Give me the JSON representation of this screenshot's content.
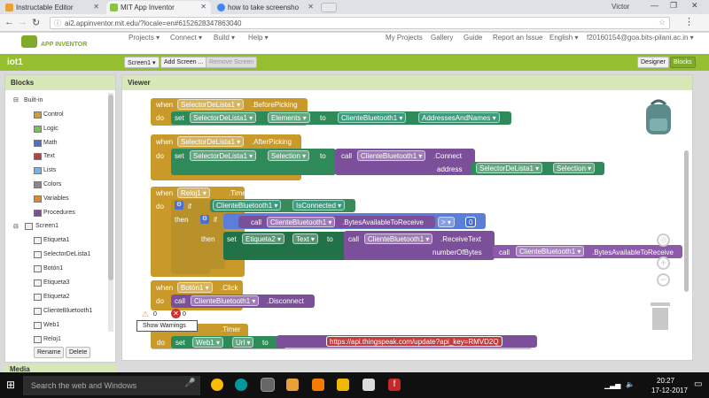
{
  "browser": {
    "tabs": [
      {
        "title": "Instructable Editor",
        "color": "#e8a13a"
      },
      {
        "title": "MIT App Inventor",
        "color": "#8bc34a"
      },
      {
        "title": "how to take screensho",
        "color": "#4285f4"
      }
    ],
    "user": "Victor",
    "url": "ai2.appinventor.mit.edu/?locale=en#6152628347863040"
  },
  "ai": {
    "logo": "APP INVENTOR",
    "menu": [
      "Projects ▾",
      "Connect ▾",
      "Build ▾",
      "Help ▾"
    ],
    "right_menu": [
      "My Projects",
      "Gallery",
      "Guide",
      "Report an Issue",
      "English ▾",
      "f20160154@goa.bits-pilani.ac.in ▾"
    ]
  },
  "project": {
    "name": "iot1",
    "screen_btn": "Screen1 ▾",
    "add_screen": "Add Screen ...",
    "remove_screen": "Remove Screen",
    "designer": "Designer",
    "blocks": "Blocks"
  },
  "blocks_panel": {
    "title": "Blocks",
    "builtin": "Built-in",
    "categories": [
      {
        "name": "Control",
        "color": "#c9a13a"
      },
      {
        "name": "Logic",
        "color": "#7cbf53"
      },
      {
        "name": "Math",
        "color": "#4a6fd1"
      },
      {
        "name": "Text",
        "color": "#c23c3c"
      },
      {
        "name": "Lists",
        "color": "#76b3e8"
      },
      {
        "name": "Colors",
        "color": "#8a8a8a"
      },
      {
        "name": "Variables",
        "color": "#e48a1d"
      },
      {
        "name": "Procedures",
        "color": "#7c4f9b"
      }
    ],
    "screen": "Screen1",
    "components": [
      "Etiqueta1",
      "SelectorDeLista1",
      "Botón1",
      "Etiqueta3",
      "Etiqueta2",
      "ClienteBluetooth1",
      "Web1",
      "Reloj1"
    ],
    "rename": "Rename",
    "delete": "Delete",
    "media": "Media"
  },
  "viewer": {
    "title": "Viewer",
    "warnings_count": "0",
    "errors_count": "0",
    "show_warnings": "Show Warnings"
  },
  "blocks": {
    "b1": {
      "when": "when",
      "comp": "SelectorDeLista1 ▾",
      "event": ".BeforePicking",
      "do": "do",
      "set": "set",
      "comp2": "SelectorDeLista1 ▾",
      "prop": "Elements ▾",
      "to": "to",
      "cb": "ClienteBluetooth1 ▾",
      "cbprop": "AddressesAndNames ▾"
    },
    "b2": {
      "when": "when",
      "comp": "SelectorDeLista1 ▾",
      "event": ".AfterPicking",
      "do": "do",
      "set": "set",
      "comp2": "SelectorDeLista1 ▾",
      "prop": "Selection ▾",
      "to": "to",
      "call": "call",
      "cb": "ClienteBluetooth1 ▾",
      "method": ".Connect",
      "address": "address",
      "sel": "SelectorDeLista1 ▾",
      "selprop": "Selection ▾"
    },
    "b3": {
      "when": "when",
      "comp": "Reloj1 ▾",
      "event": ".Timer",
      "do": "do",
      "if": "if",
      "then": "then",
      "cb": "ClienteBluetooth1 ▾",
      "isconn": "IsConnected ▾",
      "if2": "if",
      "call": "call",
      "cb2": "ClienteBluetooth1 ▾",
      "bytes": ".BytesAvailableToReceive",
      "op": "> ▾",
      "zero": "0",
      "then2": "then",
      "set": "set",
      "etq": "Etiqueta2 ▾",
      "text": "Text ▾",
      "to": "to",
      "call2": "call",
      "cb3": "ClienteBluetooth1 ▾",
      "recv": ".ReceiveText",
      "nbytes": "numberOfBytes",
      "call3": "call",
      "cb4": "ClienteBluetooth1 ▾",
      "bytes2": ".BytesAvailableToReceive"
    },
    "b4": {
      "when": "when",
      "comp": "Botón1 ▾",
      "event": ".Click",
      "do": "do",
      "call": "call",
      "cb": "ClienteBluetooth1 ▾",
      "method": ".Disconnect"
    },
    "b5": {
      "event": ".Timer",
      "do": "do",
      "set": "set",
      "web": "Web1 ▾",
      "prop": "Url ▾",
      "to": "to",
      "url": "https://api.thingspeak.com/update?api_key=RMVD2Q"
    }
  },
  "taskbar": {
    "search": "Search the web and Windows",
    "time": "20:27",
    "date": "17-12-2017"
  }
}
